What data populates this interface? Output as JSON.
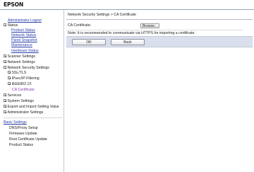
{
  "header": {
    "logo": "EPSON"
  },
  "sidebar": {
    "admin_logout": "Administrator Logout",
    "status": {
      "label": "Status",
      "items": [
        "Product Status",
        "Network Status",
        "Panel Snapshot",
        "Maintenance",
        "Hardware Status"
      ]
    },
    "groups": [
      "Scanner Settings",
      "Network Settings"
    ],
    "network_security": {
      "label": "Network Security Settings",
      "items": [
        "SSL/TLS",
        "IPsec/IP Filtering",
        "IEEE802.1X"
      ],
      "active": "CA Certificate"
    },
    "groups2": [
      "Services",
      "System Settings",
      "Export and Import Setting Value",
      "Administrator Settings"
    ],
    "basic_settings": {
      "label": "Basic Settings",
      "items": [
        "DNS/Proxy Setup",
        "Firmware Update",
        "Root Certificate Update",
        "Product Status"
      ]
    }
  },
  "main": {
    "breadcrumb": "Network Security Settings > CA Certificate",
    "ca_label": "CA Certificate:",
    "browse_label": "Browse...",
    "note": "Note: It is recommended to communicate via HTTPS for importing a certificate.",
    "ok_label": "OK",
    "back_label": "Back"
  },
  "colors": {
    "link": "#2a3fa8",
    "action_band": "#d9dfec"
  }
}
